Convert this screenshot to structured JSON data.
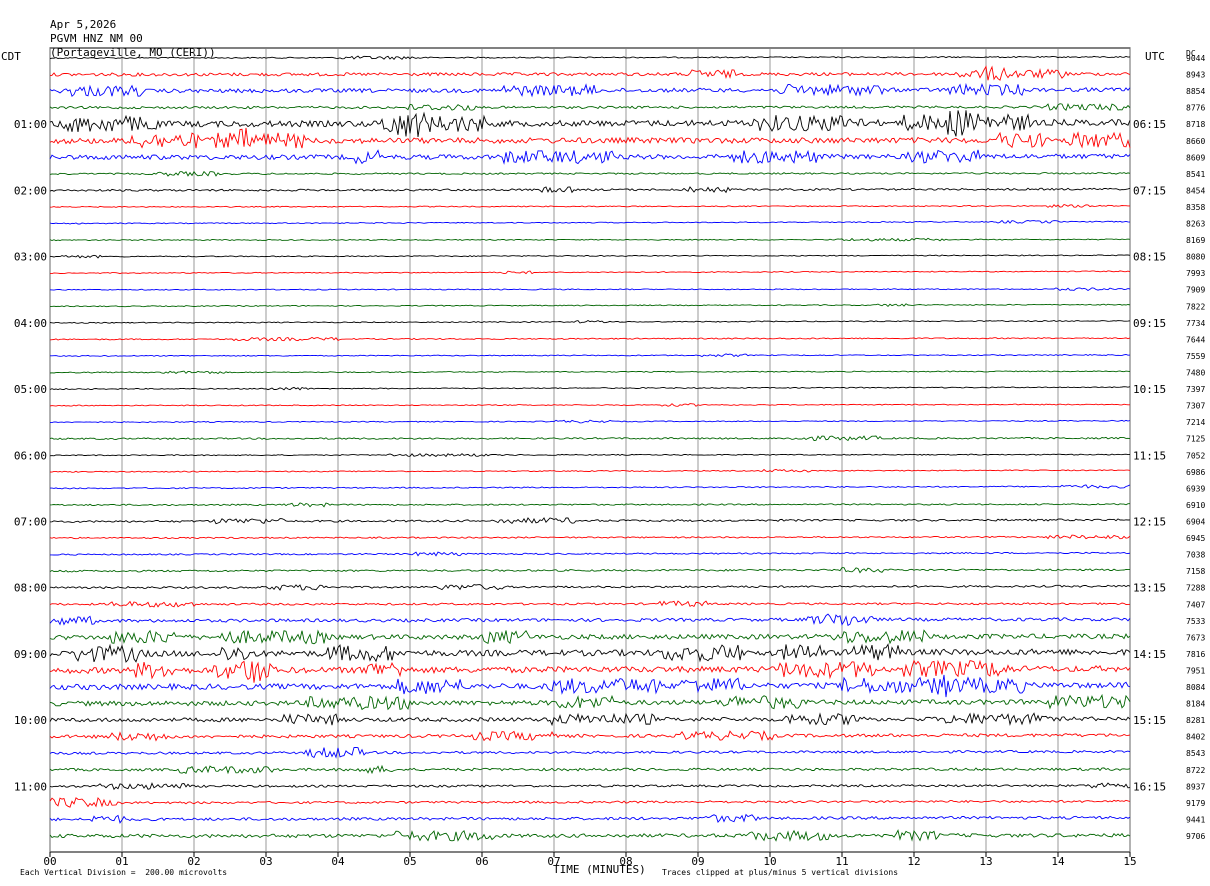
{
  "header": {
    "date": "Apr 5,2026",
    "station": "PGVM HNZ NM 00",
    "location": "(Portageville, MO (CERI))"
  },
  "left_zone_label": "CDT",
  "right_zone_label": "UTC",
  "dc_label": "DC",
  "footer": {
    "scale_note": "Each Vertical Division =  200.00 microvolts",
    "clip_note": "Traces clipped at plus/minus 5 vertical divisions"
  },
  "colors": {
    "trace_cycle": [
      "#000000",
      "#ff0000",
      "#0000ff",
      "#006400"
    ],
    "grid": "#808080"
  },
  "chart_data": {
    "type": "line",
    "title": "Apr 5,2026 PGVM HNZ NM 00 (Portageville, MO (CERI))",
    "xlabel": "TIME (MINUTES)",
    "xlim": [
      0,
      15
    ],
    "x_ticks": [
      "00",
      "01",
      "02",
      "03",
      "04",
      "05",
      "06",
      "07",
      "08",
      "09",
      "10",
      "11",
      "12",
      "13",
      "14",
      "15"
    ],
    "grid": true,
    "left_time_labels": [
      "01:00",
      "02:00",
      "03:00",
      "04:00",
      "05:00",
      "06:00",
      "07:00",
      "08:00",
      "09:00",
      "10:00",
      "11:00"
    ],
    "right_time_labels": [
      "06:15",
      "07:15",
      "08:15",
      "09:15",
      "10:15",
      "11:15",
      "12:15",
      "13:15",
      "14:15",
      "15:15",
      "16:15"
    ],
    "dc_offsets": [
      "9044",
      "8943",
      "8854",
      "8776",
      "8718",
      "8660",
      "8609",
      "8541",
      "8454",
      "8358",
      "8263",
      "8169",
      "8080",
      "7993",
      "7909",
      "7822",
      "7734",
      "7644",
      "7559",
      "7480",
      "7397",
      "7307",
      "7214",
      "7125",
      "7052",
      "6986",
      "6939",
      "6910",
      "6904",
      "6945",
      "7038",
      "7158",
      "7288",
      "7407",
      "7533",
      "7673",
      "7816",
      "7951",
      "8084",
      "8184",
      "8281",
      "8402",
      "8543",
      "8722",
      "8937",
      "9179",
      "9441",
      "9706"
    ],
    "trace_count": 48,
    "minutes_per_trace": 15,
    "activity_level": [
      0.6,
      1.6,
      2.0,
      1.2,
      3.0,
      2.8,
      2.4,
      0.8,
      1.0,
      0.5,
      0.5,
      0.5,
      0.5,
      0.5,
      0.5,
      0.5,
      0.5,
      0.6,
      0.5,
      0.5,
      0.5,
      0.5,
      0.5,
      0.8,
      0.5,
      0.5,
      0.6,
      0.7,
      1.0,
      0.7,
      0.7,
      0.9,
      1.0,
      1.0,
      1.6,
      2.4,
      3.0,
      3.0,
      2.8,
      2.4,
      2.0,
      1.6,
      1.2,
      1.3,
      1.1,
      1.1,
      1.4,
      1.8
    ]
  }
}
